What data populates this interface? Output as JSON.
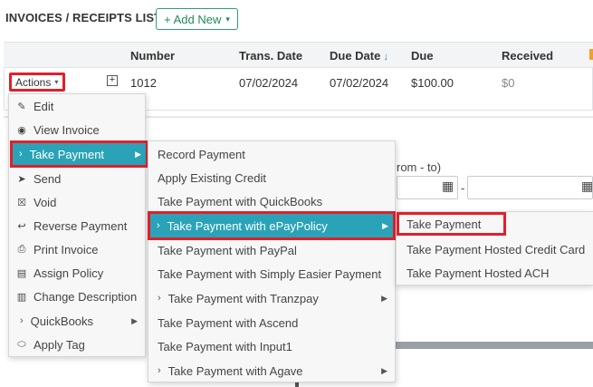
{
  "header": {
    "title": "INVOICES / RECEIPTS LIST",
    "add_new": "+ Add New"
  },
  "table": {
    "columns": [
      "Number",
      "Trans. Date",
      "Due Date",
      "Due",
      "Received"
    ],
    "sort_indicator": "↓",
    "row": {
      "actions_label": "Actions",
      "number": "1012",
      "trans_date": "07/02/2024",
      "due_date": "07/02/2024",
      "due": "$100.00",
      "received": "$0"
    }
  },
  "background": {
    "range_label_fragment": "rom - to)",
    "range_separator": "-"
  },
  "actions_menu": {
    "items": [
      {
        "label": "Edit",
        "icon": "edit-user-icon"
      },
      {
        "label": "View Invoice",
        "icon": "eye-icon"
      },
      {
        "label": "Take Payment",
        "icon": "chevron-right-icon",
        "submenu": true
      },
      {
        "label": "Send",
        "icon": "send-icon"
      },
      {
        "label": "Void",
        "icon": "void-x-icon"
      },
      {
        "label": "Reverse Payment",
        "icon": "reverse-icon"
      },
      {
        "label": "Print Invoice",
        "icon": "print-icon"
      },
      {
        "label": "Assign Policy",
        "icon": "document-icon"
      },
      {
        "label": "Change Description",
        "icon": "edit-document-icon"
      },
      {
        "label": "QuickBooks",
        "icon": "chevron-right-icon",
        "submenu": true
      },
      {
        "label": "Apply Tag",
        "icon": "tag-icon"
      }
    ]
  },
  "payment_menu": {
    "items": [
      {
        "label": "Record Payment"
      },
      {
        "label": "Apply Existing Credit"
      },
      {
        "label": "Take Payment with QuickBooks"
      },
      {
        "label": "Take Payment with ePayPolicy",
        "submenu": true
      },
      {
        "label": "Take Payment with PayPal"
      },
      {
        "label": "Take Payment with Simply Easier Payment"
      },
      {
        "label": "Take Payment with Tranzpay",
        "submenu": true
      },
      {
        "label": "Take Payment with Ascend"
      },
      {
        "label": "Take Payment with Input1"
      },
      {
        "label": "Take Payment with Agave",
        "submenu": true
      }
    ]
  },
  "epay_menu": {
    "items": [
      {
        "label": "Take Payment"
      },
      {
        "label": "Take Payment Hosted Credit Card"
      },
      {
        "label": "Take Payment Hosted ACH"
      }
    ]
  },
  "colors": {
    "accent_teal": "#2aa3b8",
    "highlight_red": "#e0202a",
    "add_new_green": "#1e8a5c",
    "sort_blue": "#2d8fd5"
  }
}
